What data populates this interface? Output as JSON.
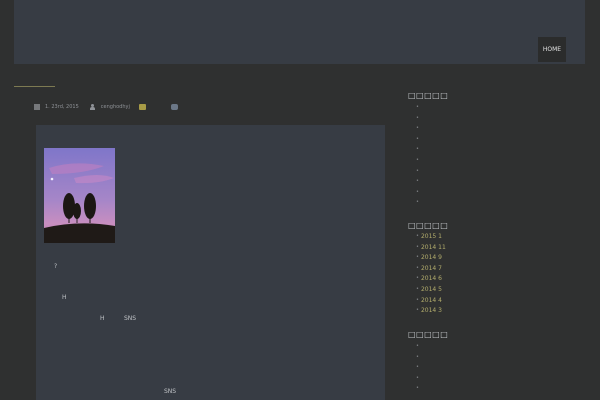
{
  "nav": {
    "home_label": "HOME"
  },
  "post": {
    "meta": {
      "date": "1. 23rd, 2015",
      "author": "cenghodhyj"
    },
    "lines": [
      "?",
      "H",
      "H",
      "SNS",
      "SNS"
    ]
  },
  "sidebar": {
    "sections": [
      {
        "heading": "□□□□□",
        "items": [
          "",
          "",
          "",
          "",
          "",
          "",
          "",
          "",
          "",
          "",
          ""
        ]
      },
      {
        "heading": "□□□□□",
        "items": [
          "2015 1",
          "2014 11",
          "2014 9",
          "2014 7",
          "2014 6",
          "2014 5",
          "2014 4",
          "2014 3"
        ]
      },
      {
        "heading": "□□□□□",
        "items": [
          "",
          "",
          "",
          "",
          ""
        ]
      }
    ]
  },
  "colors": {
    "background": "#2f3030",
    "panel": "#373c44",
    "accent_rule": "#7d7a52",
    "archive_link": "#b3ad6c"
  }
}
